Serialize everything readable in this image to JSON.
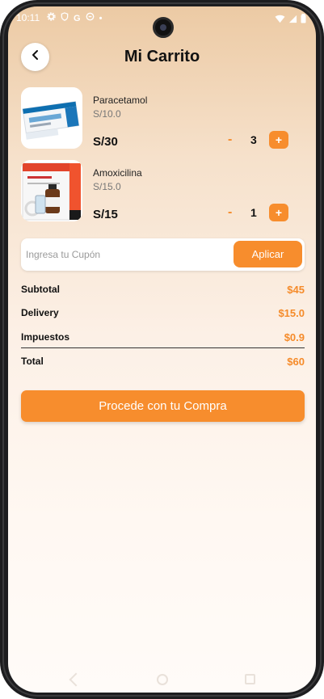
{
  "status_bar": {
    "time": "10:11",
    "icons": [
      "settings-icon",
      "shield-icon",
      "google-icon",
      "vpn-icon",
      "dot-icon"
    ],
    "right_icons": [
      "wifi-icon",
      "signal-icon",
      "battery-icon"
    ]
  },
  "header": {
    "title": "Mi Carrito",
    "back_icon": "chevron-left-icon"
  },
  "cart": {
    "items": [
      {
        "name": "Paracetamol",
        "unit_price": "S/10.0",
        "total": "S/30",
        "quantity": "3",
        "minus": "-",
        "plus": "+"
      },
      {
        "name": "Amoxicilina",
        "unit_price": "S/15.0",
        "total": "S/15",
        "quantity": "1",
        "minus": "-",
        "plus": "+"
      }
    ]
  },
  "coupon": {
    "placeholder": "Ingresa tu Cupón",
    "apply_label": "Aplicar"
  },
  "summary": {
    "subtotal_label": "Subtotal",
    "subtotal_value": "$45",
    "delivery_label": "Delivery",
    "delivery_value": "$15.0",
    "taxes_label": "Impuestos",
    "taxes_value": "$0.9",
    "total_label": "Total",
    "total_value": "$60"
  },
  "checkout": {
    "label": "Procede con tu Compra"
  },
  "colors": {
    "accent": "#f78d2d",
    "accent_text": "#f58b2a",
    "header_gradient_top": "#eccaa4",
    "background_bottom": "#fffbf8"
  }
}
